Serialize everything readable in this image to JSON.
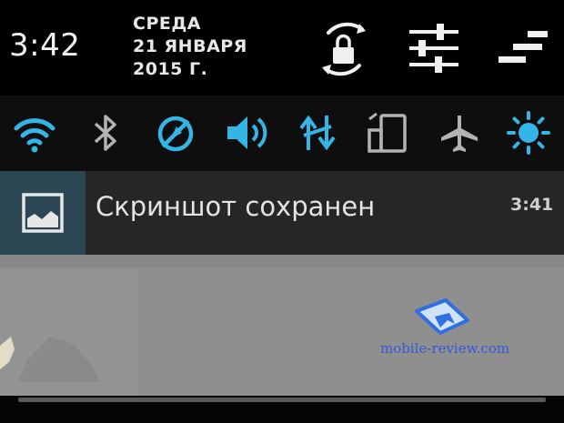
{
  "header": {
    "time": "3:42",
    "day": "СРЕДА",
    "date": "21 ЯНВАРЯ",
    "year": "2015 Г.",
    "icons": [
      "screen-rotation-lock-icon",
      "settings-sliders-icon",
      "notifications-clear-icon"
    ]
  },
  "quick_settings": {
    "tiles": [
      {
        "icon": "wifi-icon",
        "active": true
      },
      {
        "icon": "bluetooth-icon",
        "active": false
      },
      {
        "icon": "gps-location-icon",
        "active": true
      },
      {
        "icon": "sound-volume-icon",
        "active": true
      },
      {
        "icon": "data-sync-icon",
        "active": true
      },
      {
        "icon": "auto-rotate-icon",
        "active": false
      },
      {
        "icon": "airplane-mode-icon",
        "active": false
      },
      {
        "icon": "brightness-icon",
        "active": true
      }
    ],
    "colors": {
      "active": "#33b5e5",
      "inactive": "#b3b3b3"
    }
  },
  "notification": {
    "icon": "image-icon",
    "title": "Скриншот сохранен",
    "time": "3:41"
  },
  "preview": {
    "watermark": "mobile-review.com"
  }
}
